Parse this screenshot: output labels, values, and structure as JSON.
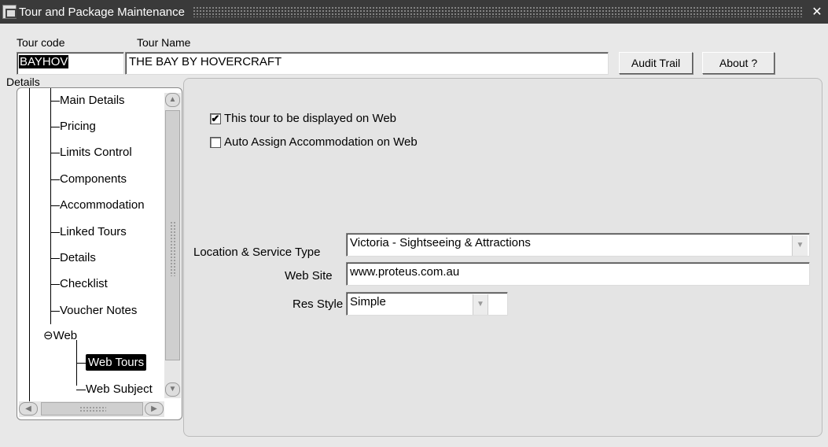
{
  "window": {
    "title": "Tour and Package Maintenance",
    "close_symbol": "✕"
  },
  "header": {
    "tour_code_label": "Tour code",
    "tour_name_label": "Tour Name",
    "tour_code_value": "BAYHOV",
    "tour_name_value": "THE BAY BY HOVERCRAFT",
    "audit_trail_label": "Audit Trail",
    "about_label": "About ?"
  },
  "details_label": "Details",
  "tree": {
    "items": [
      {
        "label": "Main Details"
      },
      {
        "label": "Pricing"
      },
      {
        "label": "Limits Control"
      },
      {
        "label": "Components"
      },
      {
        "label": "Accommodation"
      },
      {
        "label": "Linked Tours"
      },
      {
        "label": "Details"
      },
      {
        "label": "Checklist"
      },
      {
        "label": "Voucher Notes"
      },
      {
        "label": "Web"
      },
      {
        "label": "Web Tours"
      },
      {
        "label": "Web Subject"
      }
    ],
    "selected": "Web Tours",
    "expander_symbol": "⊖"
  },
  "web_options": {
    "display_on_web_label": "This tour to be displayed on Web",
    "display_on_web_checked": true,
    "auto_assign_label": "Auto Assign Accommodation on Web",
    "auto_assign_checked": false,
    "check_mark": "✔"
  },
  "form": {
    "location_label": "Location & Service Type",
    "location_value": "Victoria - Sightseeing & Attractions",
    "website_label": "Web Site",
    "website_value": "www.proteus.com.au",
    "res_style_label": "Res Style",
    "res_style_value": "Simple"
  }
}
